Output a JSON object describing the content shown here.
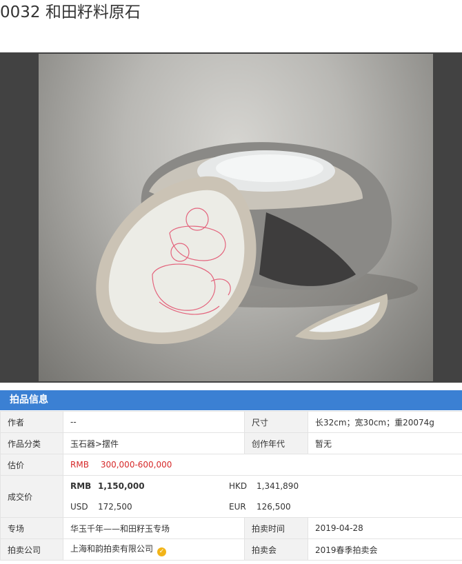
{
  "lot": {
    "title": "0032 和田籽料原石"
  },
  "section": {
    "header": "拍品信息"
  },
  "info": {
    "author_label": "作者",
    "author_value": "--",
    "size_label": "尺寸",
    "size_value": "长32cm；宽30cm；重20074g",
    "category_label": "作品分类",
    "category_value": "玉石器>摆件",
    "year_label": "创作年代",
    "year_value": "暂无",
    "estimate_label": "估价",
    "estimate_currency": "RMB",
    "estimate_value": "300,000-600,000",
    "deal_label": "成交价",
    "deal_rmb_cur": "RMB",
    "deal_rmb_value": "1,150,000",
    "deal_hkd_cur": "HKD",
    "deal_hkd_value": "1,341,890",
    "deal_usd_cur": "USD",
    "deal_usd_value": "172,500",
    "deal_eur_cur": "EUR",
    "deal_eur_value": "126,500",
    "session_label": "专场",
    "session_value": "华玉千年——和田籽玉专场",
    "date_label": "拍卖时间",
    "date_value": "2019-04-28",
    "company_label": "拍卖公司",
    "company_value": "上海和韵拍卖有限公司",
    "auction_label": "拍卖会",
    "auction_value": "2019春季拍卖会"
  },
  "colors": {
    "header_bg": "#3b80d3",
    "estimate_red": "#d62828",
    "verified_badge": "#f2b418"
  },
  "icons": {
    "company_badge": "verified-badge-icon"
  }
}
